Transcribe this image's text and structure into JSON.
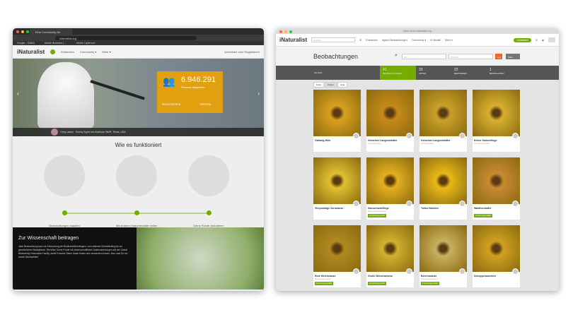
{
  "left_window": {
    "tab_title": "Eine Community für Naturfor…",
    "url": "inaturalist.org",
    "bookmarks": [
      "Google – Kalkül",
      "Adobe Illustrator (…",
      "Adobe Lightroom"
    ],
    "nav": {
      "logo": "iNaturalist",
      "items": [
        "Entdecken",
        "Community ▾",
        "Mehr ▾"
      ],
      "login": "Anmelden oder Registrieren"
    },
    "hero": {
      "count": "6.946.291",
      "count_label": "Personen beigetreten",
      "register": "REGISTRIEREN",
      "meet": "TREFFEN",
      "caption_user": "Greg Lasley",
      "caption": "Snowy Egret von Anahuac NWR, Texas, USA"
    },
    "how": {
      "title": "Wie es funktioniert",
      "steps": [
        "Beobachtungen machen",
        "Mit anderen Naturfreunden teilen",
        "Deine Funde diskutieren"
      ]
    },
    "science": {
      "title": "Zur Wissenschaft beitragen",
      "text": "Jede Beobachtung kann zur Erforschung der Biodiversität beitragen, vom seltenen Schmetterling bis zur gewöhnlichen Stadtpflanze. Wir teilen Deine Funde mit wissenschaftlichen Datensammlungen wie der Global Biodiversity Information Facility, damit Forscher Deine Daten finden und verwenden können. Also, was Du tun musst: Beobachten!"
    }
  },
  "right_window": {
    "url": "https://www.inaturalist.org",
    "nav": {
      "logo": "iNaturalist",
      "search_placeholder": "Suchen",
      "items": [
        "Entdecken",
        "eigene Beobachtungen",
        "Community ▾",
        "iD-Modell",
        "Mehr ▾"
      ],
      "upload": "Hochladen"
    },
    "header": {
      "title": "Beobachtungen",
      "species_placeholder": "Art",
      "place_placeholder": "Standort",
      "go": "Los",
      "filter": "Filter"
    },
    "stats": {
      "place": "Die Welt",
      "observations": "41",
      "observations_label": "BEOBACHTUNGEN",
      "species": "33",
      "species_label": "ARTEN",
      "identifiers": "22",
      "identifiers_label": "BESTIMMER",
      "observers": "1",
      "observers_label": "BEOBACHTER"
    },
    "views": [
      "Karte",
      "Raster",
      "Liste"
    ],
    "cards": [
      {
        "name": "Gallweg-Hüte",
        "sub": "",
        "grade": "",
        "color": "#d9a020"
      },
      {
        "name": "Gemeiner Langhornkäfer",
        "sub": "Cerambycidae",
        "grade": "",
        "color": "#c68a1a"
      },
      {
        "name": "Gemeiner Langhornkäfer",
        "sub": "Cerambycidae",
        "grade": "",
        "color": "#caa02a"
      },
      {
        "name": "Kleine Stubenfliege",
        "sub": "Fannia canicularis",
        "grade": "",
        "color": "#d8b030"
      },
      {
        "name": "Vierpunktige Zornwanze",
        "sub": "",
        "grade": "",
        "color": "#e0c030"
      },
      {
        "name": "Hainschwebfliege",
        "sub": "Episyrphus balteatus",
        "grade": "Forschungsqualität",
        "color": "#e4b020"
      },
      {
        "name": "Tolius Halictini",
        "sub": "",
        "grade": "",
        "color": "#e8b818"
      },
      {
        "name": "Waldhornkäfer",
        "sub": "",
        "grade": "Forschungsqualität",
        "color": "#c88a30"
      },
      {
        "name": "Rote Weichwanze",
        "sub": "Deraeocoris ruber",
        "grade": "Forschungsqualität",
        "color": "#b08a20"
      },
      {
        "name": "Große Wiesenameise",
        "sub": "",
        "grade": "Forschungsqualität",
        "color": "#d2b030"
      },
      {
        "name": "Beerenwanze",
        "sub": "Dolycoris baccarum",
        "grade": "Forschungsqualität",
        "color": "#c8b060"
      },
      {
        "name": "Schuppenameisen",
        "sub": "",
        "grade": "",
        "color": "#d0a020"
      }
    ]
  }
}
